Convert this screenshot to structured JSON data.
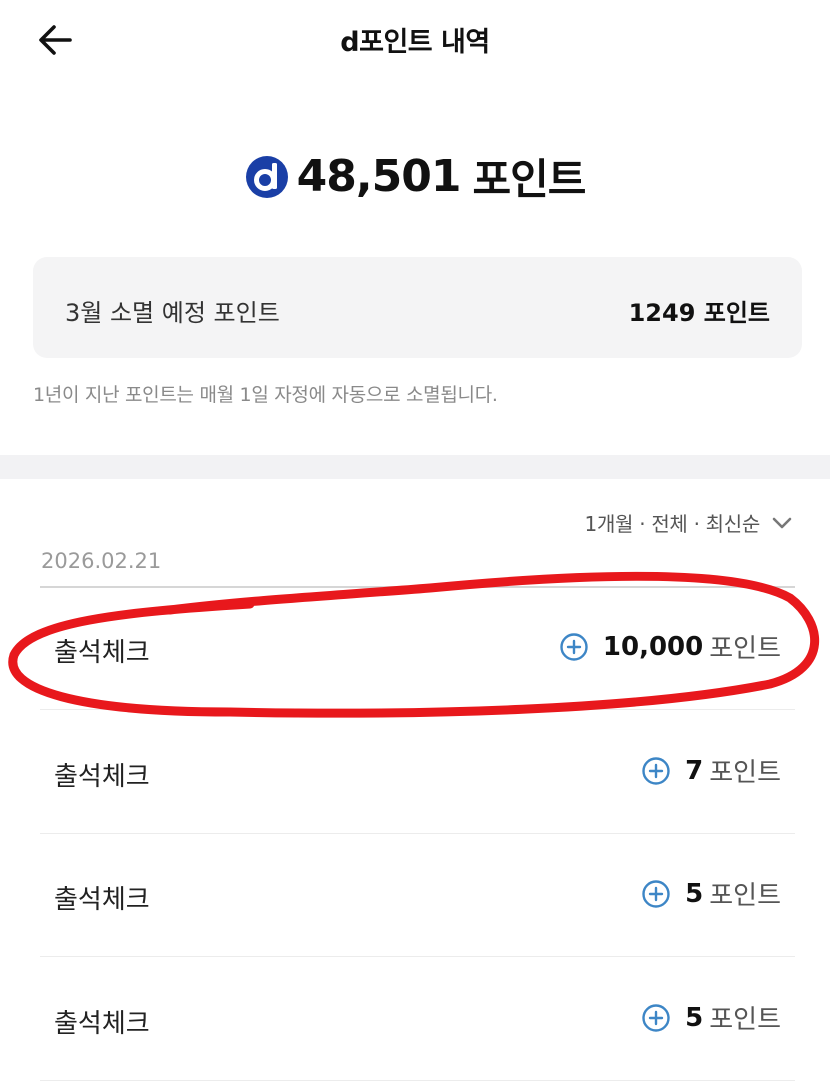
{
  "header": {
    "title": "d포인트 내역",
    "back_icon": "arrow-left-icon"
  },
  "balance": {
    "logo_icon": "d-logo-icon",
    "value": "48,501",
    "unit": "포인트"
  },
  "expiry": {
    "label": "3월 소멸 예정 포인트",
    "value": "1249 포인트"
  },
  "note": "1년이 지난 포인트는 매월 1일 자정에 자동으로 소멸됩니다.",
  "filter": {
    "label": "1개월 · 전체 · 최신순",
    "icon": "chevron-down-icon"
  },
  "history": {
    "date": "2026.02.21",
    "items": [
      {
        "title": "출석체크",
        "amount": "10,000",
        "unit": "포인트",
        "icon": "plus-circle-icon"
      },
      {
        "title": "출석체크",
        "amount": "7",
        "unit": "포인트",
        "icon": "plus-circle-icon"
      },
      {
        "title": "출석체크",
        "amount": "5",
        "unit": "포인트",
        "icon": "plus-circle-icon"
      },
      {
        "title": "출석체크",
        "amount": "5",
        "unit": "포인트",
        "icon": "plus-circle-icon"
      }
    ]
  },
  "colors": {
    "brand": "#1a3fa6",
    "accent": "#3d86c6",
    "highlight": "#e8181c"
  }
}
